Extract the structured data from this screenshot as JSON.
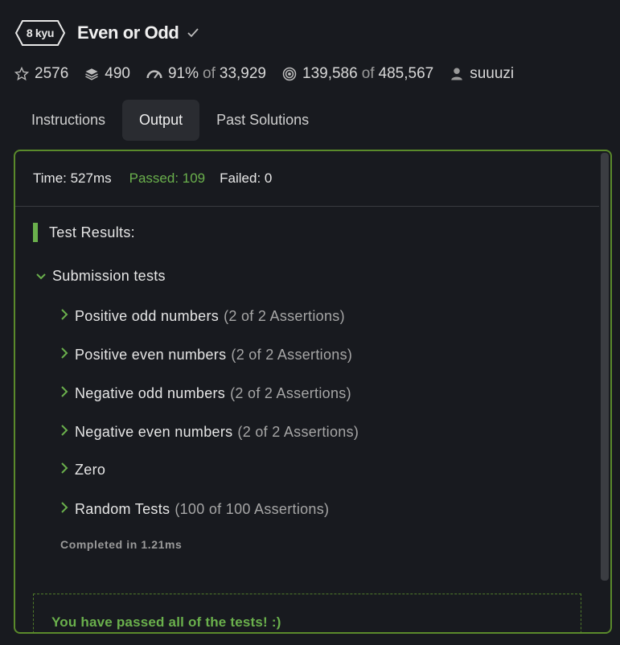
{
  "kata": {
    "kyu": "8 kyu",
    "title": "Even or Odd"
  },
  "stats": {
    "stars": "2576",
    "collections": "490",
    "satisfaction_percent": "91%",
    "satisfaction_of": "of",
    "satisfaction_votes": "33,929",
    "completed": "139,586",
    "completed_of": "of",
    "attempts": "485,567",
    "author": "suuuzi"
  },
  "tabs": [
    {
      "label": "Instructions"
    },
    {
      "label": "Output"
    },
    {
      "label": "Past Solutions"
    }
  ],
  "summary": {
    "time": "Time: 527ms",
    "passed": "Passed: 109",
    "failed": "Failed: 0"
  },
  "results": {
    "heading": "Test Results:",
    "group": "Submission tests",
    "tests": [
      {
        "name": "Positive odd numbers",
        "assertions": "(2 of 2 Assertions)"
      },
      {
        "name": "Positive even numbers",
        "assertions": "(2 of 2 Assertions)"
      },
      {
        "name": "Negative odd numbers",
        "assertions": "(2 of 2 Assertions)"
      },
      {
        "name": "Negative even numbers",
        "assertions": "(2 of 2 Assertions)"
      },
      {
        "name": "Zero",
        "assertions": ""
      },
      {
        "name": "Random Tests",
        "assertions": "(100 of 100 Assertions)"
      }
    ],
    "completed": "Completed in 1.21ms",
    "success_message": "You have passed all of the tests! :)"
  },
  "colors": {
    "accent_green": "#6ab04c",
    "panel_border": "#5a8a2b",
    "background": "#181a1f"
  }
}
